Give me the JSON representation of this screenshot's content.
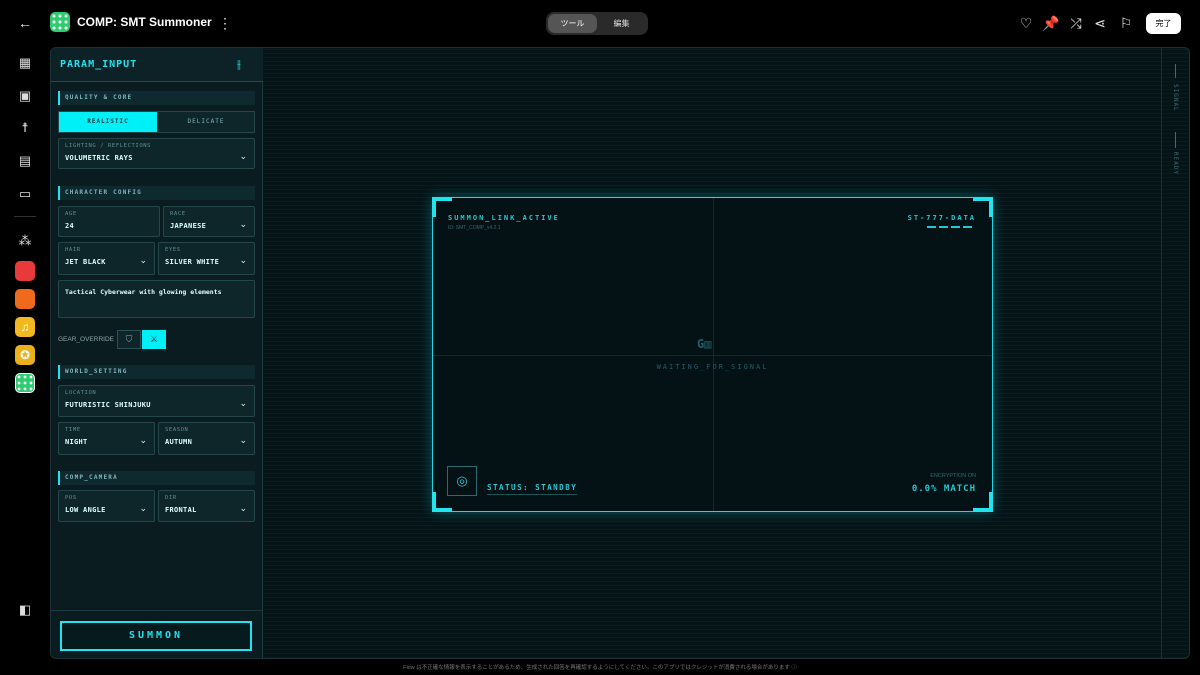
{
  "topbar": {
    "title": "COMP: SMT Summoner",
    "tabs": [
      {
        "label": "ツール",
        "active": true
      },
      {
        "label": "編集",
        "active": false
      }
    ],
    "done_label": "完了",
    "icons": [
      "back-arrow-icon",
      "more-vert-icon",
      "heart-icon",
      "pin-icon",
      "shuffle-icon",
      "share-icon",
      "flag-icon"
    ]
  },
  "rail": {
    "icons": [
      "dashboard-icon",
      "image-icon",
      "accessibility-icon",
      "movie-icon",
      "folder-upload-icon",
      "apps-sparkle-icon",
      "sidebar-toggle-icon"
    ],
    "apps": [
      {
        "name": "red-app",
        "color": "#e83a3a"
      },
      {
        "name": "orange-app",
        "color": "#f06a1e"
      },
      {
        "name": "music-app",
        "color": "#f2b81f"
      },
      {
        "name": "yellow-knot-app",
        "color": "#e9b21c"
      },
      {
        "name": "green-dots-app",
        "color": "#2ecc71"
      }
    ]
  },
  "panel": {
    "title": "PARAM_INPUT",
    "quality": {
      "header": "QUALITY & CORE",
      "options": [
        {
          "label": "REALISTIC",
          "active": true
        },
        {
          "label": "DELICATE",
          "active": false
        }
      ],
      "lighting": {
        "label": "LIGHTING / REFLECTIONS",
        "value": "VOLUMETRIC RAYS"
      }
    },
    "character": {
      "header": "CHARACTER CONFIG",
      "age": {
        "label": "AGE",
        "value": "24"
      },
      "race": {
        "label": "RACE",
        "value": "JAPANESE"
      },
      "hair": {
        "label": "HAIR",
        "value": "JET BLACK"
      },
      "eyes": {
        "label": "EYES",
        "value": "SILVER WHITE"
      },
      "outfit": "Tactical Cyberwear with glowing elements",
      "gear_label": "GEAR_OVERRIDE"
    },
    "world": {
      "header": "WORLD_SETTING",
      "location": {
        "label": "LOCATION",
        "value": "FUTURISTIC SHINJUKU"
      },
      "time": {
        "label": "TIME",
        "value": "NIGHT"
      },
      "season": {
        "label": "SEASON",
        "value": "AUTUMN"
      }
    },
    "camera": {
      "header": "COMP_CAMERA",
      "pos": {
        "label": "POS",
        "value": "LOW ANGLE"
      },
      "dir": {
        "label": "DIR",
        "value": "FRONTAL"
      }
    },
    "summon_label": "SUMMON"
  },
  "signal_bar": {
    "signal": "SIGNAL",
    "ready": "READY"
  },
  "viewer": {
    "link_status": "SUMMON_LINK_ACTIVE",
    "id": "ID: SMT_COMP_v4.2.1",
    "data_tag": "ST-777-DATA",
    "center_logo": "G▥",
    "waiting": "WAITING_FOR_SIGNAL",
    "status": "STATUS: STANDBY",
    "encryption_label": "ENCRYPTION ON",
    "match": "0.0% MATCH"
  },
  "footer": "Flow は不正確な情報を表示することがあるため、生成された回答を再確認するようにしてください。このアプリではクレジットが消費される場合があります ⓘ",
  "colors": {
    "accent": "#22e3ee",
    "bg": "#051417"
  }
}
